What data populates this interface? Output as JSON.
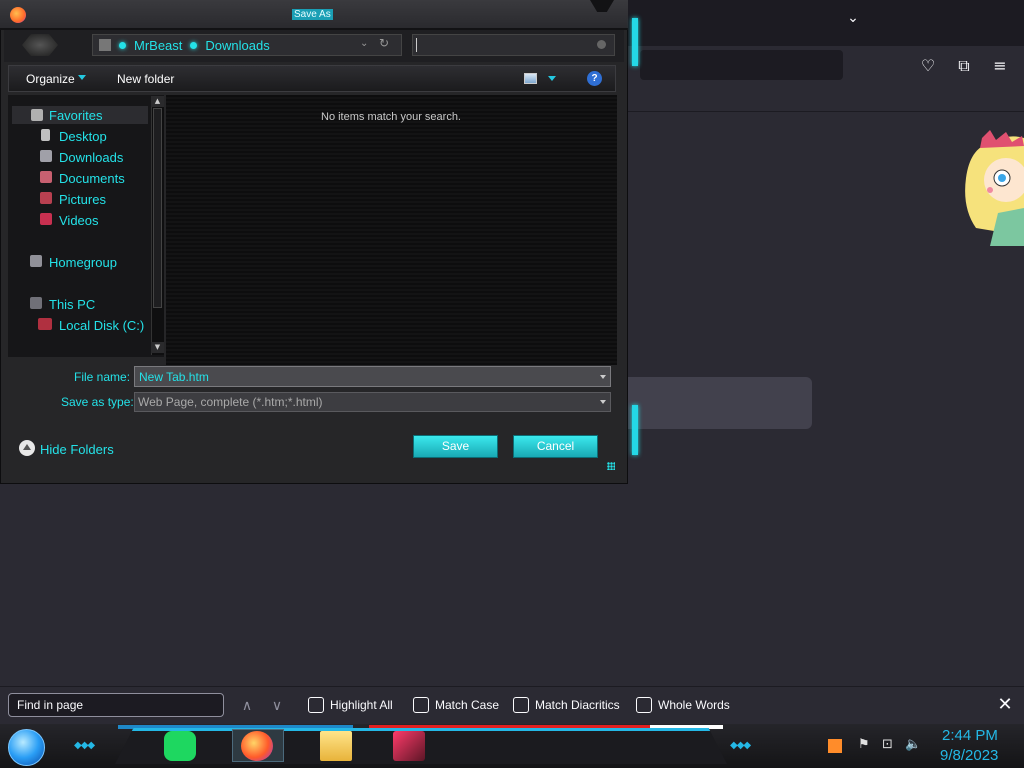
{
  "dialog": {
    "title": "Save As",
    "breadcrumb": [
      "MrBeast",
      "Downloads"
    ],
    "toolbar": {
      "organize": "Organize",
      "new_folder": "New folder",
      "help": "?"
    },
    "nav": {
      "favorites": "Favorites",
      "desktop": "Desktop",
      "downloads": "Downloads",
      "documents": "Documents",
      "pictures": "Pictures",
      "videos": "Videos",
      "homegroup": "Homegroup",
      "this_pc": "This PC",
      "local_disk": "Local Disk (C:)"
    },
    "empty_message": "No items match your search.",
    "file_name_label": "File name:",
    "file_name_value": "New Tab.htm",
    "save_type_label": "Save as type:",
    "save_type_value": "Web Page, complete (*.htm;*.html)",
    "hide_folders": "Hide Folders",
    "save_button": "Save",
    "cancel_button": "Cancel"
  },
  "findbar": {
    "placeholder": "Find in page",
    "highlight_all": "Highlight All",
    "match_case": "Match Case",
    "match_diacritics": "Match Diacritics",
    "whole_words": "Whole Words"
  },
  "taskbar": {
    "time": "2:44 PM",
    "date": "9/8/2023"
  },
  "colors": {
    "accent": "#24e2e8",
    "firefox_bg": "#2b2a33"
  }
}
